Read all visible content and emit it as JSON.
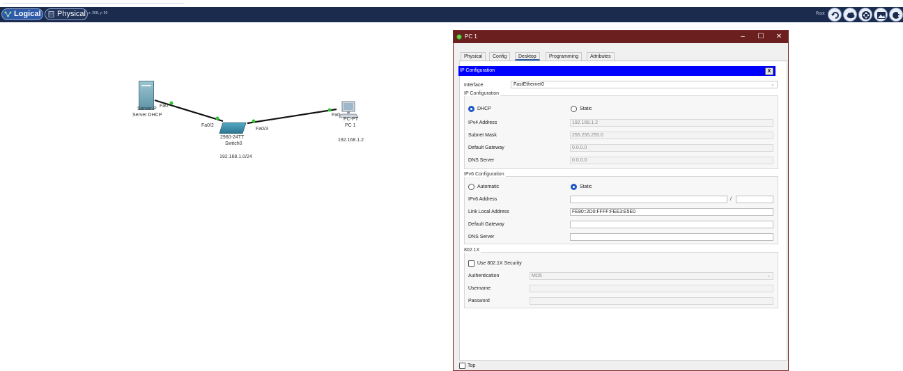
{
  "toolbar": {
    "logical_label": "Logical",
    "physical_label": "Physical",
    "coords": "x: 268, y: 99",
    "root_label": "Root",
    "icons": [
      "back-icon",
      "cloud-icon",
      "move-icon",
      "image-icon",
      "cluster-icon"
    ]
  },
  "topology": {
    "server": {
      "port": "Fa0",
      "model": "Server-P",
      "name": "Server DHCP"
    },
    "switch": {
      "port_left": "Fa0/2",
      "port_right": "Fa0/3",
      "model": "2960-24TT",
      "name": "Switch0",
      "network": "192.168.1.0/24"
    },
    "pc": {
      "port": "Fa0",
      "model": "PC-PT",
      "name": "PC 1",
      "ip": "192.168.1.2"
    }
  },
  "window": {
    "title": "PC 1",
    "tabs": [
      "Physical",
      "Config",
      "Desktop",
      "Programming",
      "Attributes"
    ],
    "active_tab": "Desktop",
    "panel_title": "IP Configuration",
    "close_label": "X",
    "interface_label": "Interface",
    "interface_value": "FastEthernet0",
    "ipv4": {
      "section_title": "IP Configuration",
      "dhcp_label": "DHCP",
      "static_label": "Static",
      "mode": "DHCP",
      "ipv4_address_label": "IPv4 Address",
      "ipv4_address": "192.168.1.2",
      "subnet_mask_label": "Subnet Mask",
      "subnet_mask": "255.255.255.0",
      "default_gateway_label": "Default Gateway",
      "default_gateway": "0.0.0.0",
      "dns_server_label": "DNS Server",
      "dns_server": "0.0.0.0"
    },
    "ipv6": {
      "section_title": "IPv6 Configuration",
      "automatic_label": "Automatic",
      "static_label": "Static",
      "mode": "Static",
      "ipv6_address_label": "IPv6 Address",
      "ipv6_address": "",
      "prefix_separator": "/",
      "prefix_length": "",
      "link_local_label": "Link Local Address",
      "link_local": "FE80::2D0:FFFF:FEE3:E5E0",
      "default_gateway_label": "Default Gateway",
      "default_gateway": "",
      "dns_server_label": "DNS Server",
      "dns_server": ""
    },
    "dot1x": {
      "section_title": "802.1X",
      "use_label": "Use 802.1X Security",
      "authentication_label": "Authentication",
      "authentication_value": "MD5",
      "username_label": "Username",
      "username": "",
      "password_label": "Password",
      "password": ""
    },
    "top_checkbox_label": "Top"
  }
}
